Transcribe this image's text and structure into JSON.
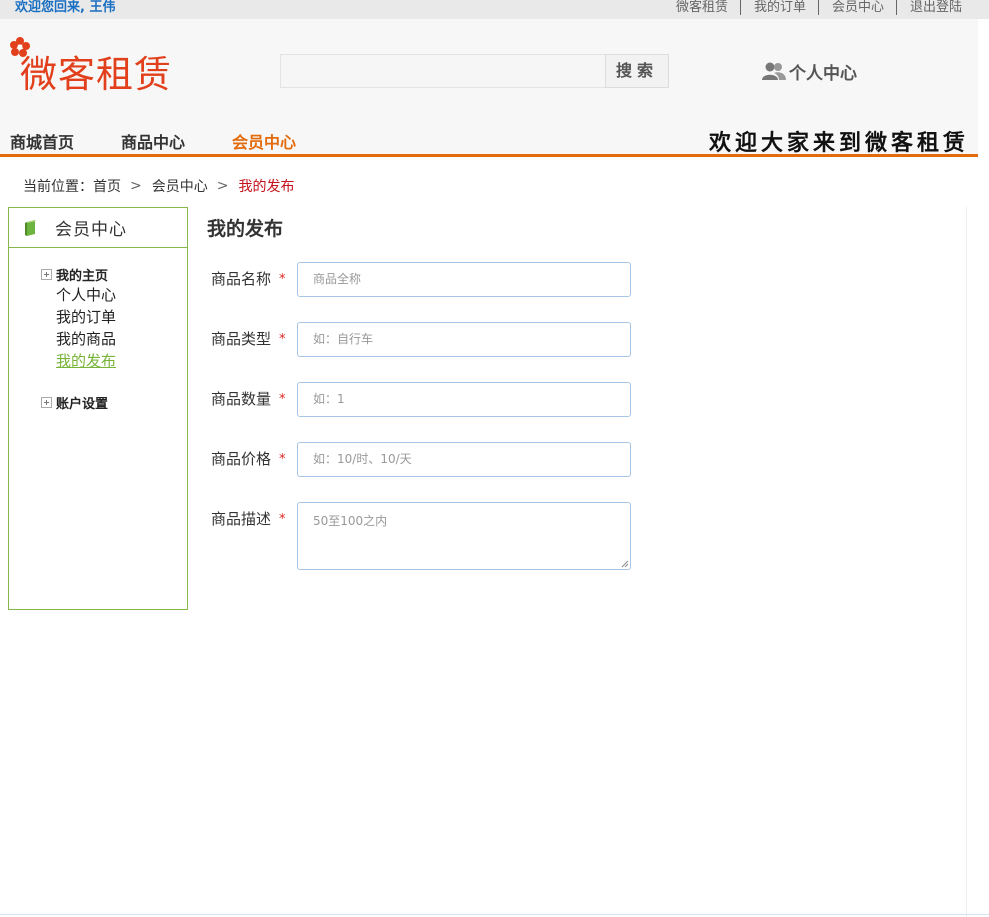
{
  "topbar": {
    "welcome": "欢迎您回来, 王伟",
    "links": [
      "微客租赁",
      "我的订单",
      "会员中心",
      "退出登陆"
    ]
  },
  "header": {
    "logo_text": "微客租赁",
    "search_button": "搜索",
    "personal_center": "个人中心",
    "nav": [
      "商城首页",
      "商品中心",
      "会员中心"
    ],
    "nav_active_index": 2,
    "slogan": "欢迎大家来到微客租赁"
  },
  "breadcrumb": {
    "prefix": "当前位置：",
    "items": [
      "首页",
      "会员中心",
      "我的发布"
    ],
    "separator": ">"
  },
  "sidebar": {
    "title": "会员中心",
    "groups": [
      {
        "title": "我的主页",
        "items": [
          "个人中心",
          "我的订单",
          "我的商品",
          "我的发布"
        ],
        "active_item": "我的发布"
      },
      {
        "title": "账户设置",
        "items": []
      }
    ]
  },
  "form": {
    "title": "我的发布",
    "required_mark": "*",
    "fields": [
      {
        "label": "商品名称",
        "placeholder": "商品全称"
      },
      {
        "label": "商品类型",
        "placeholder": "如：自行车"
      },
      {
        "label": "商品数量",
        "placeholder": "如：1"
      },
      {
        "label": "商品价格",
        "placeholder": "如：10/时、10/天"
      },
      {
        "label": "商品描述",
        "placeholder": "50至100之内"
      }
    ]
  },
  "colors": {
    "accent_orange": "#e36b0c",
    "sidebar_green": "#86b948",
    "active_link_green": "#78b43a",
    "breadcrumb_current_red": "#c3121b",
    "welcome_blue": "#1a6fc2"
  }
}
